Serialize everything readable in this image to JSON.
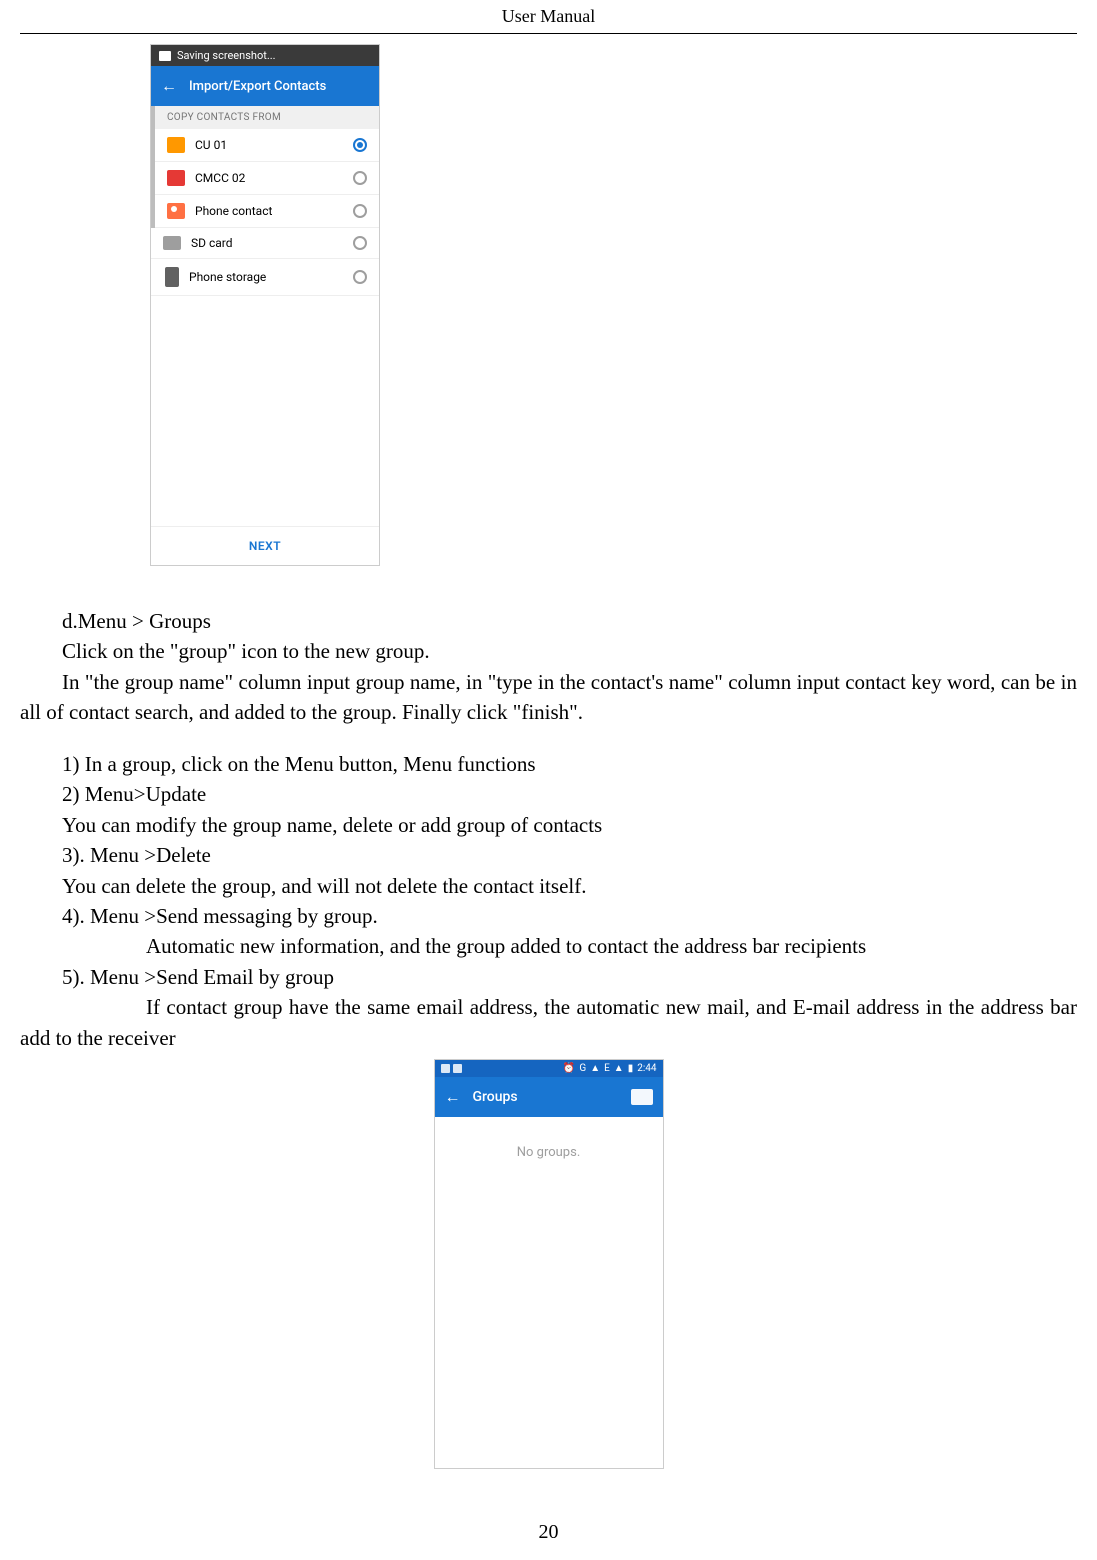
{
  "header": "User    Manual",
  "page_number": "20",
  "screenshot1": {
    "status_banner": "Saving screenshot...",
    "app_bar_title": "Import/Export Contacts",
    "section_header": "COPY CONTACTS FROM",
    "items": [
      {
        "label": "CU 01",
        "selected": true
      },
      {
        "label": "CMCC 02",
        "selected": false
      },
      {
        "label": "Phone contact",
        "selected": false
      },
      {
        "label": "SD card",
        "selected": false
      },
      {
        "label": "Phone storage",
        "selected": false
      }
    ],
    "next_label": "NEXT"
  },
  "text": {
    "d_title": "d.Menu > Groups",
    "p1": "Click on the \"group\" icon to the new group.",
    "p2": "In \"the group name\" column input group name, in \"type in the contact's name\" column input contact key word, can be in all of contact search, and added to the group. Finally click \"finish\".",
    "l1": "1)    In a group, click on the Menu button,    Menu functions",
    "l2": "2)    Menu>Update",
    "l2b": "You can modify the group name, delete or add group of contacts",
    "l3": "3).    Menu >Delete",
    "l3b": "You can delete the group, and will not delete the contact itself.",
    "l4": "4).    Menu >Send messaging by group.",
    "l4b": "Automatic new information, and the group added to contact the address bar recipients",
    "l5": "5).    Menu >Send Email by group",
    "l5b": "If contact group have the same email address, the automatic new mail, and E-mail address in the address bar add to the receiver"
  },
  "screenshot2": {
    "status_time": "2:44",
    "status_net": "G",
    "status_sig": "E",
    "app_bar_title": "Groups",
    "empty_text": "No groups."
  }
}
